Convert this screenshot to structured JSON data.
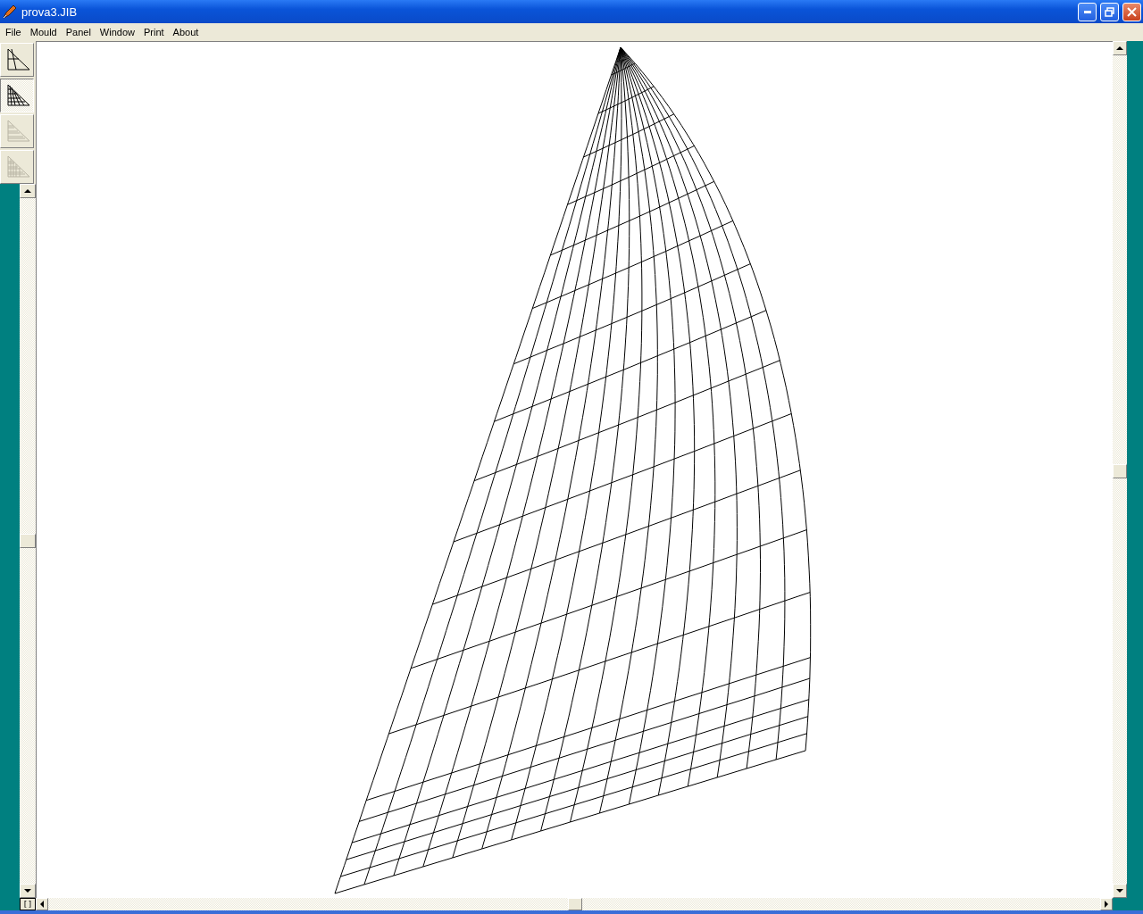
{
  "window": {
    "title": "prova3.JIB"
  },
  "menu": [
    {
      "label": "File"
    },
    {
      "label": "Mould"
    },
    {
      "label": "Panel"
    },
    {
      "label": "Window"
    },
    {
      "label": "Print"
    },
    {
      "label": "About"
    }
  ],
  "tools": [
    {
      "kind": "panels",
      "selected": false,
      "disabled": false
    },
    {
      "kind": "mesh",
      "selected": true,
      "disabled": false
    },
    {
      "kind": "stripes",
      "selected": false,
      "disabled": true
    },
    {
      "kind": "stripes-mesh",
      "selected": false,
      "disabled": true
    }
  ],
  "corner_icon": "[]"
}
